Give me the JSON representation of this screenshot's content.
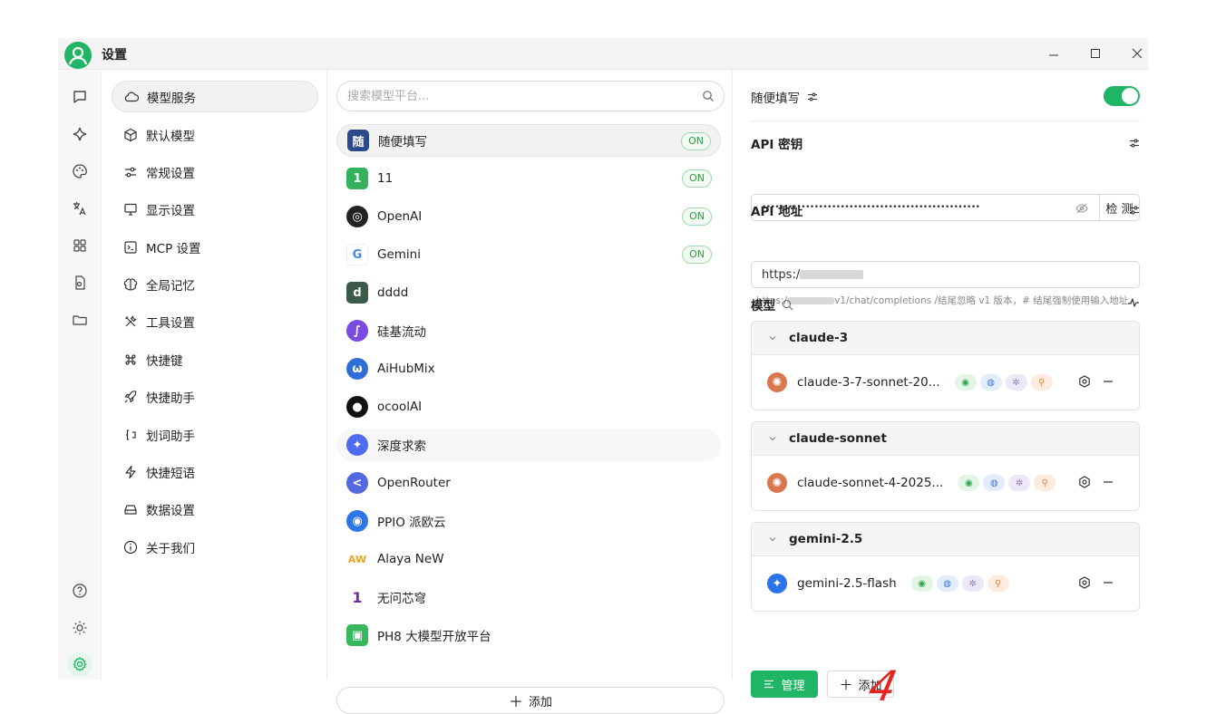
{
  "window": {
    "title": "设置"
  },
  "menu": [
    {
      "label": "模型服务",
      "icon": "cloud-icon",
      "active": true
    },
    {
      "label": "默认模型",
      "icon": "cube-icon"
    },
    {
      "label": "常规设置",
      "icon": "sliders-icon"
    },
    {
      "label": "显示设置",
      "icon": "monitor-icon"
    },
    {
      "label": "MCP 设置",
      "icon": "terminal-icon"
    },
    {
      "label": "全局记忆",
      "icon": "brain-icon"
    },
    {
      "label": "工具设置",
      "icon": "tools-icon"
    },
    {
      "label": "快捷键",
      "icon": "command-icon"
    },
    {
      "label": "快捷助手",
      "icon": "rocket-icon"
    },
    {
      "label": "划词助手",
      "icon": "text-cursor-icon"
    },
    {
      "label": "快捷短语",
      "icon": "zap-icon"
    },
    {
      "label": "数据设置",
      "icon": "hard-drive-icon"
    },
    {
      "label": "关于我们",
      "icon": "info-icon"
    }
  ],
  "providers": {
    "search_placeholder": "搜索模型平台...",
    "on_label": "ON",
    "add_label": "添加",
    "items": [
      {
        "name": "随便填写",
        "logo_text": "随",
        "color": "#2b4a8b",
        "on": true,
        "active": true
      },
      {
        "name": "11",
        "logo_text": "1",
        "color": "#34b15c",
        "on": true
      },
      {
        "name": "OpenAI",
        "logo_text": "◎",
        "color": "#222222",
        "on": true
      },
      {
        "name": "Gemini",
        "logo_text": "G",
        "color": "#ffffff",
        "on": true
      },
      {
        "name": "dddd",
        "logo_text": "d",
        "color": "#3c5a49",
        "on": false
      },
      {
        "name": "硅基流动",
        "logo_text": "∫",
        "color": "#7b4ae2",
        "on": false
      },
      {
        "name": "AiHubMix",
        "logo_text": "ω",
        "color": "#2f6ed8",
        "on": false
      },
      {
        "name": "ocoolAI",
        "logo_text": "●",
        "color": "#111111",
        "on": false
      },
      {
        "name": "深度求索",
        "logo_text": "✦",
        "color": "#4f6cf0",
        "on": false
      },
      {
        "name": "OpenRouter",
        "logo_text": "<",
        "color": "#5469e0",
        "on": false
      },
      {
        "name": "PPIO 派欧云",
        "logo_text": "◉",
        "color": "#2c76e8",
        "on": false
      },
      {
        "name": "Alaya NeW",
        "logo_text": "AW",
        "color": "#f2a324",
        "on": false
      },
      {
        "name": "无问芯穹",
        "logo_text": "1",
        "color": "#6b2fa6",
        "on": false
      },
      {
        "name": "PH8 大模型开放平台",
        "logo_text": "▣",
        "color": "#38b85c",
        "on": false
      }
    ]
  },
  "detail": {
    "provider_title": "随便填写",
    "api_key_label": "API 密钥",
    "api_key_value": "••••••••••••••••••••••••••••••••••••••••••••••••••",
    "check_label": "检 测",
    "api_url_label": "API 地址",
    "api_url_prefix": "https:/",
    "hint_prefix": "https:/",
    "hint_suffix": "v1/chat/completions /结尾忽略 v1 版本，# 结尾强制使用输入地址",
    "models_label": "模型",
    "groups": [
      {
        "name": "claude-3",
        "model": "claude-3-7-sonnet-20...",
        "logo_color": "#d9774e",
        "logo_glyph": "✺"
      },
      {
        "name": "claude-sonnet",
        "model": "claude-sonnet-4-2025...",
        "logo_color": "#d9774e",
        "logo_glyph": "✺"
      },
      {
        "name": "gemini-2.5",
        "model": "gemini-2.5-flash",
        "logo_color": "#2c72e8",
        "logo_glyph": "✦"
      }
    ],
    "manage_label": "管理",
    "add_label": "添加",
    "annotation": "4"
  }
}
